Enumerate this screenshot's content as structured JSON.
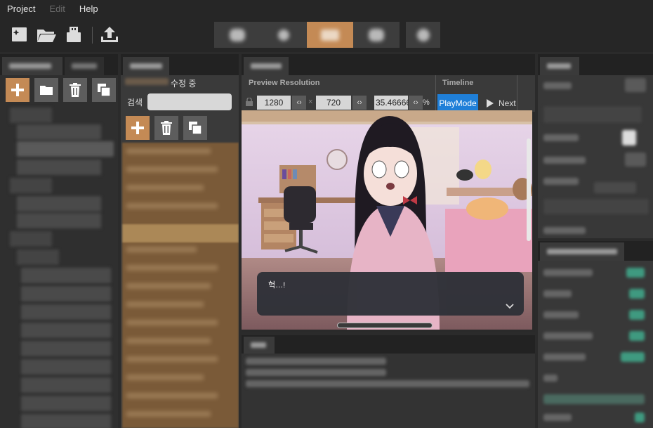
{
  "menu": {
    "project": "Project",
    "edit": "Edit",
    "help": "Help"
  },
  "toolbar": {
    "icons": [
      "new-file-icon",
      "open-folder-icon",
      "usb-icon",
      "upload-icon"
    ]
  },
  "editor": {
    "editing_label": "수정 중",
    "search_label": "검색",
    "search_value": ""
  },
  "preview": {
    "resolution_label": "Preview Resolution",
    "width": "1280",
    "height": "720",
    "zoom": "35.46666",
    "percent": "%",
    "timeline_label": "Timeline",
    "playmode_label": "PlayMode",
    "next_label": "Next",
    "dialog_text": "헉…!"
  },
  "colors": {
    "accent": "#c48a55",
    "playmode": "#1f7fd8",
    "panel": "#333333",
    "background": "#2b2b2b"
  }
}
